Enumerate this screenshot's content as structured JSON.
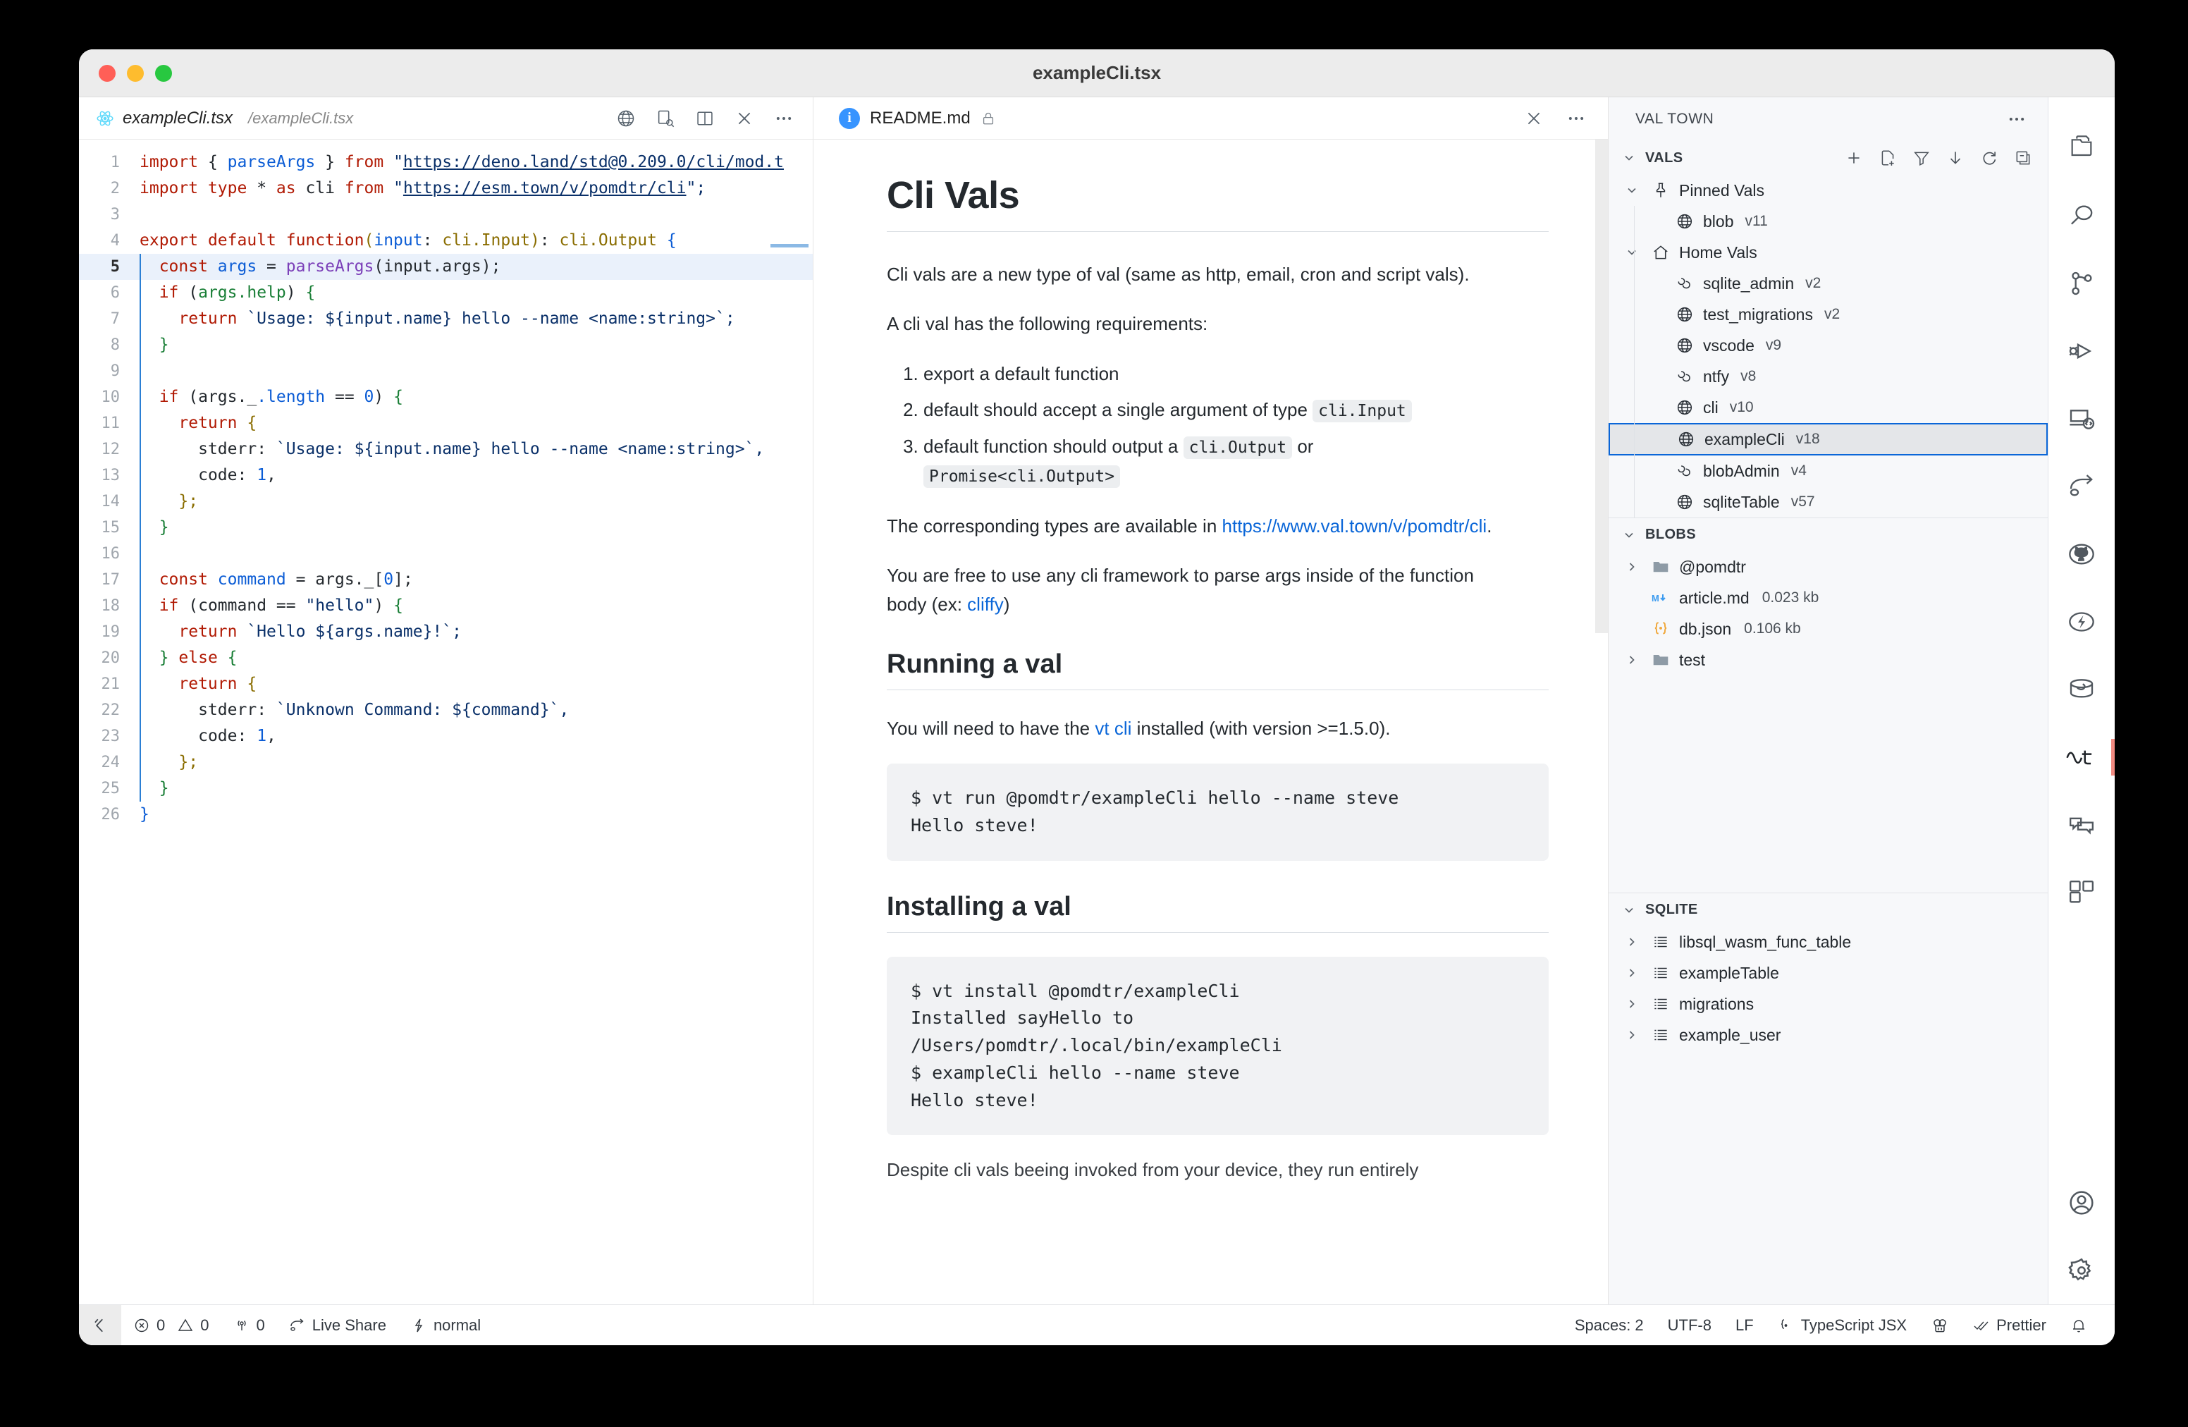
{
  "window": {
    "title": "exampleCli.tsx",
    "traffic_lights": [
      "close",
      "minimize",
      "zoom"
    ]
  },
  "editor": {
    "tab": {
      "icon": "react-icon",
      "label": "exampleCli.tsx",
      "path": "/exampleCli.tsx"
    },
    "actions": [
      "globe-icon",
      "open-preview-icon",
      "split-editor-icon",
      "close-icon",
      "more-actions-icon"
    ],
    "language": "TypeScript JSX",
    "lines": [
      {
        "n": "1",
        "tokens": [
          {
            "t": "import ",
            "c": "kw"
          },
          {
            "t": "{ ",
            "c": "br"
          },
          {
            "t": "parseArgs",
            "c": "var"
          },
          {
            "t": " } ",
            "c": "br"
          },
          {
            "t": "from ",
            "c": "kw"
          },
          {
            "t": "\"",
            "c": "str"
          },
          {
            "t": "https://deno.land/std@0.209.0/cli/mod.t",
            "c": "lnk"
          }
        ]
      },
      {
        "n": "2",
        "tokens": [
          {
            "t": "import ",
            "c": "kw"
          },
          {
            "t": "type ",
            "c": "kw"
          },
          {
            "t": "* ",
            "c": "op"
          },
          {
            "t": "as ",
            "c": "kw"
          },
          {
            "t": "cli ",
            "c": "pl"
          },
          {
            "t": "from ",
            "c": "kw"
          },
          {
            "t": "\"",
            "c": "str"
          },
          {
            "t": "https://esm.town/v/pomdtr/cli",
            "c": "lnk"
          },
          {
            "t": "\";",
            "c": "str"
          }
        ]
      },
      {
        "n": "3",
        "tokens": []
      },
      {
        "n": "4",
        "tokens": [
          {
            "t": "export ",
            "c": "kw"
          },
          {
            "t": "default ",
            "c": "kw"
          },
          {
            "t": "function",
            "c": "kw"
          },
          {
            "t": "(",
            "c": "brc"
          },
          {
            "t": "input",
            "c": "pr"
          },
          {
            "t": ": ",
            "c": "pl"
          },
          {
            "t": "cli.Input",
            "c": "ty"
          },
          {
            "t": ")",
            "c": "brc"
          },
          {
            "t": ": ",
            "c": "pl"
          },
          {
            "t": "cli.Output ",
            "c": "ty"
          },
          {
            "t": "{",
            "c": "pr"
          }
        ]
      },
      {
        "n": "5",
        "active": true,
        "tokens": [
          {
            "t": "  ",
            "c": "pl"
          },
          {
            "t": "const ",
            "c": "kw"
          },
          {
            "t": "args ",
            "c": "var"
          },
          {
            "t": "= ",
            "c": "op"
          },
          {
            "t": "parseArgs",
            "c": "fn"
          },
          {
            "t": "(",
            "c": "pl"
          },
          {
            "t": "input.args",
            "c": "pl"
          },
          {
            "t": ");",
            "c": "pl"
          }
        ]
      },
      {
        "n": "6",
        "tokens": [
          {
            "t": "  ",
            "c": "pl"
          },
          {
            "t": "if ",
            "c": "kw"
          },
          {
            "t": "(",
            "c": "pl"
          },
          {
            "t": "args.help",
            "c": "grn"
          },
          {
            "t": ") ",
            "c": "pl"
          },
          {
            "t": "{",
            "c": "grn"
          }
        ]
      },
      {
        "n": "7",
        "tokens": [
          {
            "t": "    ",
            "c": "pl"
          },
          {
            "t": "return ",
            "c": "kw"
          },
          {
            "t": "`Usage: ${input.name} hello --name <name:string>`;",
            "c": "str"
          }
        ]
      },
      {
        "n": "8",
        "tokens": [
          {
            "t": "  ",
            "c": "pl"
          },
          {
            "t": "}",
            "c": "grn"
          }
        ]
      },
      {
        "n": "9",
        "tokens": []
      },
      {
        "n": "10",
        "tokens": [
          {
            "t": "  ",
            "c": "pl"
          },
          {
            "t": "if ",
            "c": "kw"
          },
          {
            "t": "(",
            "c": "pl"
          },
          {
            "t": "args._",
            "c": "pl"
          },
          {
            "t": ".length ",
            "c": "var"
          },
          {
            "t": "== ",
            "c": "op"
          },
          {
            "t": "0",
            "c": "num"
          },
          {
            "t": ") ",
            "c": "pl"
          },
          {
            "t": "{",
            "c": "grn"
          }
        ]
      },
      {
        "n": "11",
        "tokens": [
          {
            "t": "    ",
            "c": "pl"
          },
          {
            "t": "return ",
            "c": "kw"
          },
          {
            "t": "{",
            "c": "brc"
          }
        ]
      },
      {
        "n": "12",
        "tokens": [
          {
            "t": "      ",
            "c": "pl"
          },
          {
            "t": "stderr",
            "c": "pl"
          },
          {
            "t": ": ",
            "c": "pl"
          },
          {
            "t": "`Usage: ${input.name} hello --name <name:string>`,",
            "c": "str"
          }
        ]
      },
      {
        "n": "13",
        "tokens": [
          {
            "t": "      ",
            "c": "pl"
          },
          {
            "t": "code",
            "c": "pl"
          },
          {
            "t": ": ",
            "c": "pl"
          },
          {
            "t": "1",
            "c": "num"
          },
          {
            "t": ",",
            "c": "pl"
          }
        ]
      },
      {
        "n": "14",
        "tokens": [
          {
            "t": "    ",
            "c": "pl"
          },
          {
            "t": "};",
            "c": "brc"
          }
        ]
      },
      {
        "n": "15",
        "tokens": [
          {
            "t": "  ",
            "c": "pl"
          },
          {
            "t": "}",
            "c": "grn"
          }
        ]
      },
      {
        "n": "16",
        "tokens": []
      },
      {
        "n": "17",
        "tokens": [
          {
            "t": "  ",
            "c": "pl"
          },
          {
            "t": "const ",
            "c": "kw"
          },
          {
            "t": "command ",
            "c": "var"
          },
          {
            "t": "= ",
            "c": "op"
          },
          {
            "t": "args._",
            "c": "pl"
          },
          {
            "t": "[",
            "c": "pl"
          },
          {
            "t": "0",
            "c": "num"
          },
          {
            "t": "];",
            "c": "pl"
          }
        ]
      },
      {
        "n": "18",
        "tokens": [
          {
            "t": "  ",
            "c": "pl"
          },
          {
            "t": "if ",
            "c": "kw"
          },
          {
            "t": "(",
            "c": "pl"
          },
          {
            "t": "command ",
            "c": "pl"
          },
          {
            "t": "== ",
            "c": "op"
          },
          {
            "t": "\"hello\"",
            "c": "str"
          },
          {
            "t": ") ",
            "c": "pl"
          },
          {
            "t": "{",
            "c": "grn"
          }
        ]
      },
      {
        "n": "19",
        "tokens": [
          {
            "t": "    ",
            "c": "pl"
          },
          {
            "t": "return ",
            "c": "kw"
          },
          {
            "t": "`Hello ${args.name}!`;",
            "c": "str"
          }
        ]
      },
      {
        "n": "20",
        "tokens": [
          {
            "t": "  ",
            "c": "pl"
          },
          {
            "t": "} ",
            "c": "grn"
          },
          {
            "t": "else ",
            "c": "kw"
          },
          {
            "t": "{",
            "c": "grn"
          }
        ]
      },
      {
        "n": "21",
        "tokens": [
          {
            "t": "    ",
            "c": "pl"
          },
          {
            "t": "return ",
            "c": "kw"
          },
          {
            "t": "{",
            "c": "brc"
          }
        ]
      },
      {
        "n": "22",
        "tokens": [
          {
            "t": "      ",
            "c": "pl"
          },
          {
            "t": "stderr",
            "c": "pl"
          },
          {
            "t": ": ",
            "c": "pl"
          },
          {
            "t": "`Unknown Command: ${command}`,",
            "c": "str"
          }
        ]
      },
      {
        "n": "23",
        "tokens": [
          {
            "t": "      ",
            "c": "pl"
          },
          {
            "t": "code",
            "c": "pl"
          },
          {
            "t": ": ",
            "c": "pl"
          },
          {
            "t": "1",
            "c": "num"
          },
          {
            "t": ",",
            "c": "pl"
          }
        ]
      },
      {
        "n": "24",
        "tokens": [
          {
            "t": "    ",
            "c": "pl"
          },
          {
            "t": "};",
            "c": "brc"
          }
        ]
      },
      {
        "n": "25",
        "tokens": [
          {
            "t": "  ",
            "c": "pl"
          },
          {
            "t": "}",
            "c": "grn"
          }
        ]
      },
      {
        "n": "26",
        "tokens": [
          {
            "t": "}",
            "c": "var"
          }
        ]
      }
    ]
  },
  "readme": {
    "tab": {
      "icon": "markdown-preview-icon",
      "label": "README.md",
      "lock_icon": "lock-icon"
    },
    "actions": [
      "close-icon",
      "more-actions-icon"
    ],
    "h1": "Cli Vals",
    "p1": "Cli vals are a new type of val (same as http, email, cron and script vals).",
    "p2": "A cli val has the following requirements:",
    "list": [
      {
        "pre": "export a default function",
        "code": "",
        "post": ""
      },
      {
        "pre": "default should accept a single argument of type ",
        "code": "cli.Input",
        "post": ""
      },
      {
        "pre": "default function should output a ",
        "code": "cli.Output",
        "post": " or ",
        "code2": "Promise<cli.Output>"
      }
    ],
    "p3_pre": "The corresponding types are available in ",
    "p3_link": "https://www.val.town/v/pomdtr/cli",
    "p3_post": ".",
    "p4_pre": "You are free to use any cli framework to parse args inside of the function body (ex: ",
    "p4_link": "cliffy",
    "p4_post": ")",
    "h2_running": "Running a val",
    "p5_pre": "You will need to have the ",
    "p5_link": "vt cli",
    "p5_post": " installed (with version >=1.5.0).",
    "code_run": "$ vt run @pomdtr/exampleCli hello --name steve\nHello steve!",
    "h2_installing": "Installing a val",
    "code_install": "$ vt install @pomdtr/exampleCli\nInstalled sayHello to\n/Users/pomdtr/.local/bin/exampleCli\n$ exampleCli hello --name steve\nHello steve!",
    "p6": "Despite cli vals beeing invoked from your device, they run entirely"
  },
  "sidebar": {
    "title": "VAL TOWN",
    "more_label": "···",
    "sections": [
      {
        "id": "vals",
        "label": "VALS",
        "actions": [
          "add-icon",
          "new-file-icon",
          "filter-icon",
          "download-icon",
          "refresh-icon",
          "collapse-all-icon"
        ]
      },
      {
        "id": "blobs",
        "label": "BLOBS"
      },
      {
        "id": "sqlite",
        "label": "SQLITE"
      }
    ],
    "vals": {
      "groups": [
        {
          "label": "Pinned Vals",
          "icon": "pin-icon",
          "expanded": true,
          "items": [
            {
              "icon": "globe-icon",
              "name": "blob",
              "version": "v11"
            }
          ]
        },
        {
          "label": "Home Vals",
          "icon": "home-icon",
          "expanded": true,
          "items": [
            {
              "icon": "script-icon",
              "name": "sqlite_admin",
              "version": "v2"
            },
            {
              "icon": "globe-icon",
              "name": "test_migrations",
              "version": "v2"
            },
            {
              "icon": "globe-icon",
              "name": "vscode",
              "version": "v9"
            },
            {
              "icon": "script-icon",
              "name": "ntfy",
              "version": "v8"
            },
            {
              "icon": "globe-icon",
              "name": "cli",
              "version": "v10"
            },
            {
              "icon": "globe-icon",
              "name": "exampleCli",
              "version": "v18",
              "selected": true
            },
            {
              "icon": "script-icon",
              "name": "blobAdmin",
              "version": "v4"
            },
            {
              "icon": "globe-icon",
              "name": "sqliteTable",
              "version": "v57"
            }
          ]
        }
      ]
    },
    "blobs": [
      {
        "icon": "folder-icon",
        "name": "@pomdtr",
        "collapsible": true
      },
      {
        "icon": "markdown-file-icon",
        "name": "article.md",
        "size": "0.023 kb"
      },
      {
        "icon": "json-file-icon",
        "name": "db.json",
        "size": "0.106 kb"
      },
      {
        "icon": "folder-icon",
        "name": "test",
        "collapsible": true
      }
    ],
    "sqlite": [
      {
        "icon": "table-icon",
        "name": "libsql_wasm_func_table"
      },
      {
        "icon": "table-icon",
        "name": "exampleTable"
      },
      {
        "icon": "table-icon",
        "name": "migrations"
      },
      {
        "icon": "table-icon",
        "name": "example_user"
      }
    ]
  },
  "activitybar": {
    "items": [
      {
        "icon": "explorer-icon",
        "active": false
      },
      {
        "icon": "search-icon",
        "active": false
      },
      {
        "icon": "source-control-icon",
        "active": false
      },
      {
        "icon": "run-and-debug-icon",
        "active": false
      },
      {
        "icon": "remote-explorer-icon",
        "active": false
      },
      {
        "icon": "live-share-icon",
        "active": false
      },
      {
        "icon": "github-icon",
        "active": false
      },
      {
        "icon": "deno-icon",
        "active": false
      },
      {
        "icon": "database-icon",
        "active": false
      },
      {
        "icon": "val-town-icon",
        "active": true
      },
      {
        "icon": "comments-icon",
        "active": false
      },
      {
        "icon": "extensions-icon",
        "active": false
      }
    ],
    "bottom": [
      {
        "icon": "account-icon"
      },
      {
        "icon": "gear-icon"
      }
    ]
  },
  "statusbar": {
    "remote_icon": "remote-window-icon",
    "left": [
      {
        "icon": "error-icon",
        "label": "0",
        "icon2": "warning-icon",
        "label2": "0"
      },
      {
        "icon": "ports-icon",
        "label": "0"
      },
      {
        "icon": "live-share-icon",
        "label": "Live Share"
      },
      {
        "icon": "zap-icon",
        "label": "normal"
      }
    ],
    "right": [
      {
        "label": "Spaces: 2"
      },
      {
        "label": "UTF-8"
      },
      {
        "label": "LF"
      },
      {
        "icon": "braces-icon",
        "label": "TypeScript JSX"
      },
      {
        "icon": "deno-icon",
        "label": ""
      },
      {
        "icon": "check-icon",
        "label": "Prettier"
      },
      {
        "icon": "bell-icon",
        "label": ""
      }
    ]
  },
  "colors": {
    "accent": "#0a66d8",
    "selection": "#e4e6e9",
    "active_line": "#eaf1fb",
    "sidebar_bg": "#f7f8fa",
    "activity_active": "#f28b82"
  }
}
